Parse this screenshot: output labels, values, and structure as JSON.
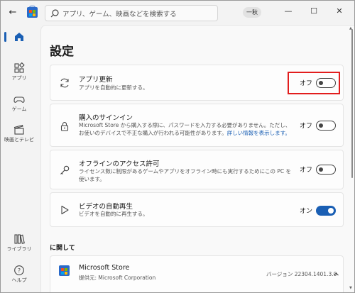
{
  "titlebar": {
    "back_label": "←",
    "search_placeholder": "アプリ、ゲーム、映画などを検索する",
    "account_label": "一秋",
    "minimize": "—",
    "maximize": "☐",
    "close": "✕"
  },
  "sidebar": {
    "items": [
      {
        "label": "",
        "icon": "home-icon",
        "active": true
      },
      {
        "label": "アプリ",
        "icon": "apps-icon"
      },
      {
        "label": "ゲーム",
        "icon": "gamepad-icon"
      },
      {
        "label": "映画とテレビ",
        "icon": "clapperboard-icon"
      },
      {
        "label": "ライブラリ",
        "icon": "library-icon"
      },
      {
        "label": "ヘルプ",
        "icon": "help-icon"
      }
    ]
  },
  "page": {
    "title": "設定"
  },
  "settings": [
    {
      "title": "アプリ更新",
      "description": "アプリを自動的に更新する。",
      "toggle_label": "オフ",
      "state": "off",
      "icon": "refresh-icon"
    },
    {
      "title": "購入のサインイン",
      "description": "Microsoft Store から購入する際に、パスワードを入力する必要がありません。ただし、お使いのデバイスで不正な購入が行われる可能性があります。",
      "link": "詳しい情報を表示します。",
      "toggle_label": "オフ",
      "state": "off",
      "icon": "lock-icon"
    },
    {
      "title": "オフラインのアクセス許可",
      "description": "ライセンス数に制限があるゲームやアプリをオフライン時にも実行するためにこの PC を使います。",
      "toggle_label": "オフ",
      "state": "off",
      "icon": "key-icon"
    },
    {
      "title": "ビデオの自動再生",
      "description": "ビデオを自動的に再生する。",
      "toggle_label": "オン",
      "state": "on",
      "icon": "play-icon"
    }
  ],
  "about": {
    "heading": "に関して",
    "app_name": "Microsoft Store",
    "publisher": "提供元: Microsoft Corporation",
    "version": "バージョン 22304.1401.3.0",
    "expand_icon": "chevron-up-icon"
  },
  "colors": {
    "accent": "#1a5fb4",
    "highlight": "#e21d1d"
  }
}
